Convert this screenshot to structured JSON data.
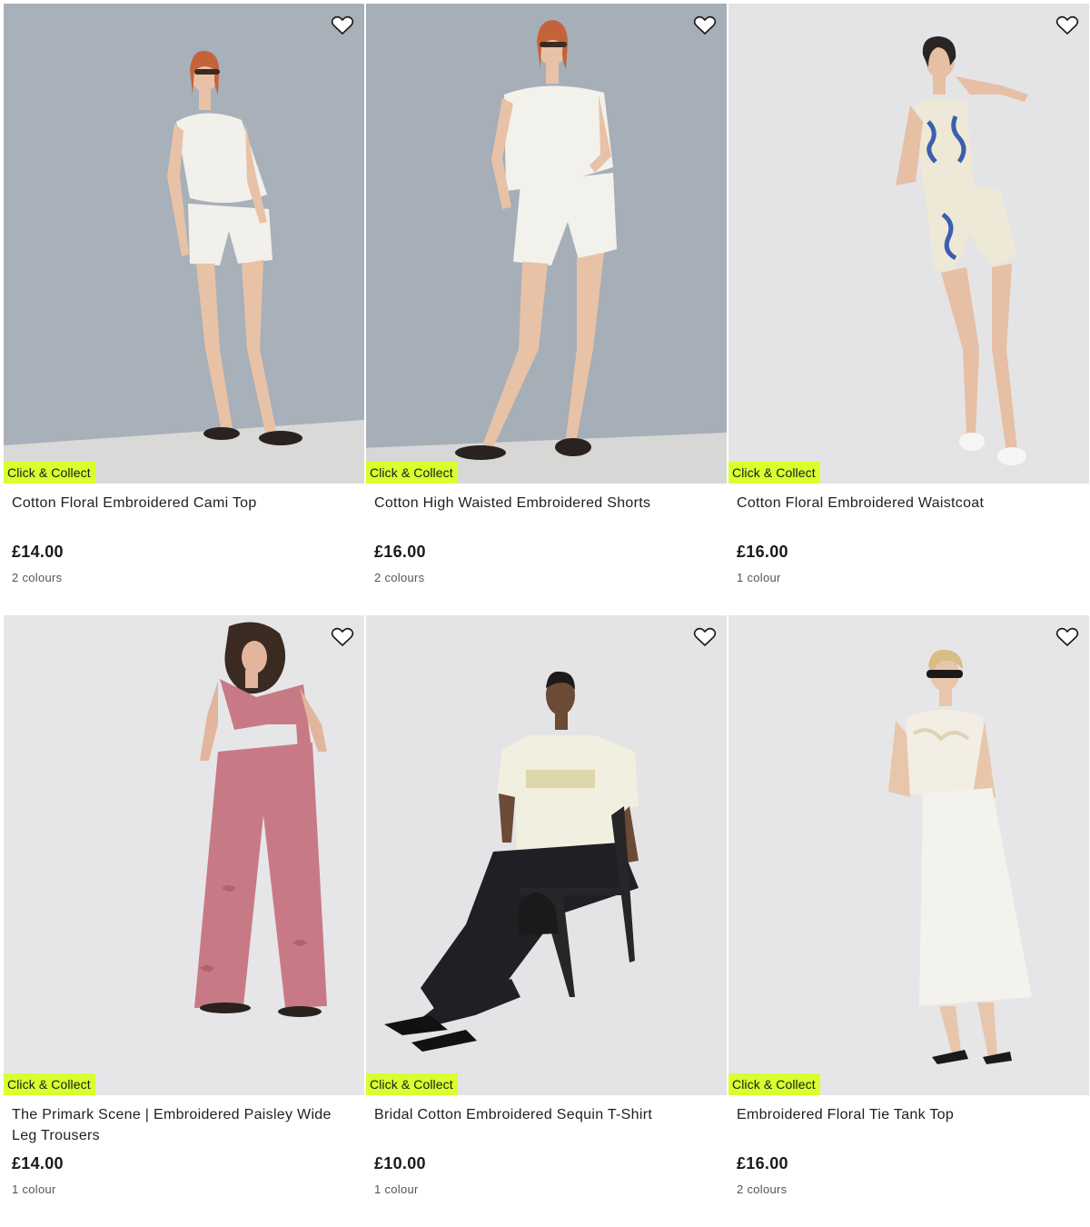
{
  "products": [
    {
      "title": "Cotton Floral Embroidered Cami Top",
      "price": "£14.00",
      "colours": "2 colours",
      "badge": "Click & Collect",
      "wall_color": "#a8b0ba",
      "floor_color": "#d9d9d7",
      "outfit_color": "#f2f0ea",
      "image": "model-in-white-cami-and-shorts"
    },
    {
      "title": "Cotton High Waisted Embroidered Shorts",
      "price": "£16.00",
      "colours": "2 colours",
      "badge": "Click & Collect",
      "wall_color": "#a6aeb8",
      "floor_color": "#d7d7d5",
      "outfit_color": "#f3f1eb",
      "image": "model-in-white-embroidered-shorts"
    },
    {
      "title": "Cotton Floral Embroidered Waistcoat",
      "price": "£16.00",
      "colours": "1 colour",
      "badge": "Click & Collect",
      "wall_color": "#e4e4e6",
      "floor_color": "#dedee0",
      "outfit_color": "#eee8d6",
      "image": "model-in-blue-floral-waistcoat"
    },
    {
      "title": "The Primark Scene | Embroidered Paisley Wide Leg Trousers",
      "price": "£14.00",
      "colours": "1 colour",
      "badge": "Click & Collect",
      "wall_color": "#e6e6e8",
      "floor_color": "#e1e1e3",
      "outfit_color": "#c77a86",
      "image": "model-in-pink-paisley-trousers"
    },
    {
      "title": "Bridal Cotton Embroidered Sequin T-Shirt",
      "price": "£10.00",
      "colours": "1 colour",
      "badge": "Click & Collect",
      "wall_color": "#e4e4e6",
      "floor_color": "#dfdfe1",
      "outfit_color": "#f1efdf",
      "image": "model-seated-in-sequin-t-shirt"
    },
    {
      "title": "Embroidered Floral Tie Tank Top",
      "price": "£16.00",
      "colours": "2 colours",
      "badge": "Click & Collect",
      "wall_color": "#e6e6e8",
      "floor_color": "#e1e1e3",
      "outfit_color": "#f2eee4",
      "image": "model-in-floral-tank-and-white-skirt"
    }
  ],
  "icons": {
    "wishlist": "heart-outline-icon"
  },
  "accent_color": "#d8ff2e"
}
